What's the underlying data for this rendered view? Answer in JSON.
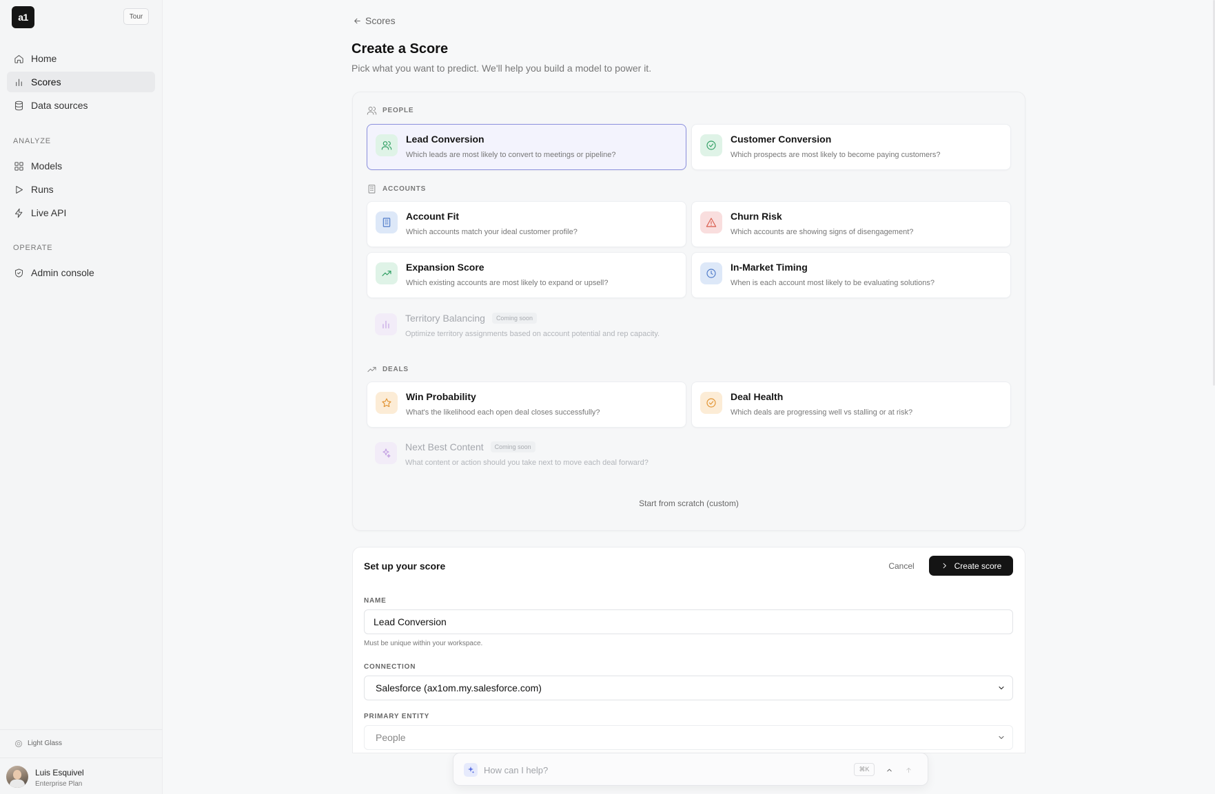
{
  "sidebar": {
    "logo_text": "a1",
    "tour_label": "Tour",
    "nav": [
      {
        "label": "Home",
        "icon": "home-icon"
      },
      {
        "label": "Scores",
        "icon": "bar-chart-icon",
        "active": true
      },
      {
        "label": "Data sources",
        "icon": "database-icon"
      }
    ],
    "sections": [
      {
        "title": "ANALYZE",
        "items": [
          {
            "label": "Models",
            "icon": "grid-icon"
          },
          {
            "label": "Runs",
            "icon": "play-icon"
          },
          {
            "label": "Live API",
            "icon": "bolt-icon"
          }
        ]
      },
      {
        "title": "OPERATE",
        "items": [
          {
            "label": "Admin console",
            "icon": "shield-check-icon"
          }
        ]
      }
    ],
    "theme_label": "Light Glass",
    "user": {
      "name": "Luis Esquivel",
      "plan": "Enterprise Plan"
    }
  },
  "header": {
    "back_label": "Scores",
    "title": "Create a Score",
    "subtitle": "Pick what you want to predict. We'll help you build a model to power it."
  },
  "categories": {
    "people": "PEOPLE",
    "accounts": "ACCOUNTS",
    "deals": "DEALS"
  },
  "templates": {
    "lead_conversion": {
      "title": "Lead Conversion",
      "desc": "Which leads are most likely to convert to meetings or pipeline?"
    },
    "customer_conversion": {
      "title": "Customer Conversion",
      "desc": "Which prospects are most likely to become paying customers?"
    },
    "account_fit": {
      "title": "Account Fit",
      "desc": "Which accounts match your ideal customer profile?"
    },
    "churn_risk": {
      "title": "Churn Risk",
      "desc": "Which accounts are showing signs of disengagement?"
    },
    "expansion_score": {
      "title": "Expansion Score",
      "desc": "Which existing accounts are most likely to expand or upsell?"
    },
    "in_market_timing": {
      "title": "In-Market Timing",
      "desc": "When is each account most likely to be evaluating solutions?"
    },
    "territory_balancing": {
      "title": "Territory Balancing",
      "badge": "Coming soon",
      "desc": "Optimize territory assignments based on account potential and rep capacity."
    },
    "win_probability": {
      "title": "Win Probability",
      "desc": "What's the likelihood each open deal closes successfully?"
    },
    "deal_health": {
      "title": "Deal Health",
      "desc": "Which deals are progressing well vs stalling or at risk?"
    },
    "next_best_content": {
      "title": "Next Best Content",
      "badge": "Coming soon",
      "desc": "What content or action should you take next to move each deal forward?"
    }
  },
  "scratch_label": "Start from scratch (custom)",
  "setup": {
    "title": "Set up your score",
    "cancel_label": "Cancel",
    "create_label": "Create score",
    "name_label": "NAME",
    "name_value": "Lead Conversion",
    "name_hint": "Must be unique within your workspace.",
    "connection_label": "CONNECTION",
    "connection_value": "Salesforce (ax1om.my.salesforce.com)",
    "entity_label": "PRIMARY ENTITY",
    "entity_value": "People"
  },
  "assistant": {
    "placeholder": "How can I help?",
    "shortcut": "⌘K"
  }
}
